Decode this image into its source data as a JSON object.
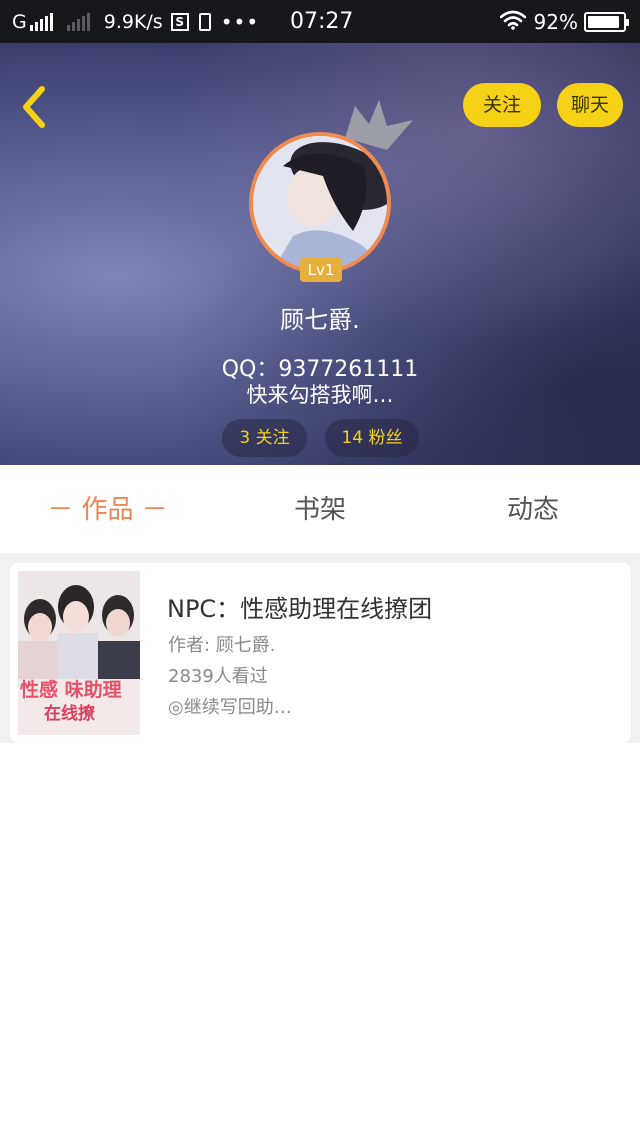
{
  "status_bar": {
    "carrier": "G",
    "speed": "9.9K/s",
    "sim_icon_letter": "S",
    "more": "•••",
    "time": "07:27",
    "battery": "92%",
    "battery_level": 0.92
  },
  "header": {
    "follow_label": "关注",
    "chat_label": "聊天",
    "level": "Lv1",
    "nickname": "顾七爵.",
    "qq": "QQ：9377261111",
    "bio": "快来勾搭我啊…",
    "following_stat": "3 关注",
    "fans_stat": "14 粉丝",
    "accent_color": "#f6d216"
  },
  "tabs": {
    "works": "－ 作品 －",
    "shelf": "书架",
    "feed": "动态",
    "active_color": "#ef8550"
  },
  "book": {
    "title": "NPC：性感助理在线撩团",
    "author": "作者: 顾七爵.",
    "views": "2839人看过",
    "continue": "◎继续写回助…",
    "cover_text_line1": "性感 味助理",
    "cover_text_line2": "在线撩"
  },
  "icons": {
    "back": "chevron-left-icon",
    "crown": "crown-icon",
    "wifi": "wifi-icon"
  }
}
